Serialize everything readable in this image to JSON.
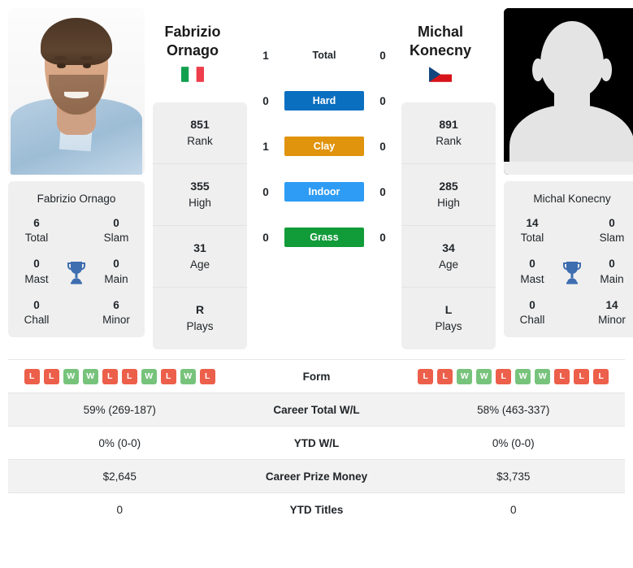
{
  "players": {
    "left": {
      "first_name": "Fabrizio",
      "last_name": "Ornago",
      "full_name": "Fabrizio Ornago",
      "country": "Italy",
      "flag_icon": "flag-italy-icon",
      "photo_type": "player-photo",
      "rank": "851",
      "rank_label": "Rank",
      "high": "355",
      "high_label": "High",
      "age": "31",
      "age_label": "Age",
      "plays": "R",
      "plays_label": "Plays",
      "titles": {
        "total": "6",
        "total_label": "Total",
        "slam": "0",
        "slam_label": "Slam",
        "mast": "0",
        "mast_label": "Mast",
        "main": "0",
        "main_label": "Main",
        "chall": "0",
        "chall_label": "Chall",
        "minor": "6",
        "minor_label": "Minor"
      },
      "form": [
        "L",
        "L",
        "W",
        "W",
        "L",
        "L",
        "W",
        "L",
        "W",
        "L"
      ],
      "career_total_wl": "59% (269-187)",
      "ytd_wl": "0% (0-0)",
      "career_prize_money": "$2,645",
      "ytd_titles": "0"
    },
    "right": {
      "first_name": "Michal",
      "last_name": "Konecny",
      "full_name": "Michal Konecny",
      "country": "Czech Republic",
      "flag_icon": "flag-czech-icon",
      "photo_type": "player-photo-placeholder",
      "rank": "891",
      "rank_label": "Rank",
      "high": "285",
      "high_label": "High",
      "age": "34",
      "age_label": "Age",
      "plays": "L",
      "plays_label": "Plays",
      "titles": {
        "total": "14",
        "total_label": "Total",
        "slam": "0",
        "slam_label": "Slam",
        "mast": "0",
        "mast_label": "Mast",
        "main": "0",
        "main_label": "Main",
        "chall": "0",
        "chall_label": "Chall",
        "minor": "14",
        "minor_label": "Minor"
      },
      "form": [
        "L",
        "L",
        "W",
        "W",
        "L",
        "W",
        "W",
        "L",
        "L",
        "L"
      ],
      "career_total_wl": "58% (463-337)",
      "ytd_wl": "0% (0-0)",
      "career_prize_money": "$3,735",
      "ytd_titles": "0"
    }
  },
  "head_to_head": [
    {
      "surface": "Total",
      "left": "1",
      "right": "0",
      "color": "",
      "style": "plain"
    },
    {
      "surface": "Hard",
      "left": "0",
      "right": "0",
      "color": "#0b6fc0",
      "style": "pill"
    },
    {
      "surface": "Clay",
      "left": "1",
      "right": "0",
      "color": "#e0930c",
      "style": "pill"
    },
    {
      "surface": "Indoor",
      "left": "0",
      "right": "0",
      "color": "#2e9cf5",
      "style": "pill"
    },
    {
      "surface": "Grass",
      "left": "0",
      "right": "0",
      "color": "#119b39",
      "style": "pill"
    }
  ],
  "table_rows": [
    {
      "label": "Form",
      "left": "",
      "right": "",
      "type": "form"
    },
    {
      "label": "Career Total W/L",
      "left": "59% (269-187)",
      "right": "58% (463-337)",
      "type": "text"
    },
    {
      "label": "YTD W/L",
      "left": "0% (0-0)",
      "right": "0% (0-0)",
      "type": "text"
    },
    {
      "label": "Career Prize Money",
      "left": "$2,645",
      "right": "$3,735",
      "type": "text"
    },
    {
      "label": "YTD Titles",
      "left": "0",
      "right": "0",
      "type": "text"
    }
  ],
  "colors": {
    "hard": "#0b6fc0",
    "clay": "#e0930c",
    "indoor": "#2e9cf5",
    "grass": "#119b39",
    "win_badge": "#77c37c",
    "loss_badge": "#ec5f4a",
    "trophy": "#3e6db0",
    "card_bg": "#efefef"
  }
}
